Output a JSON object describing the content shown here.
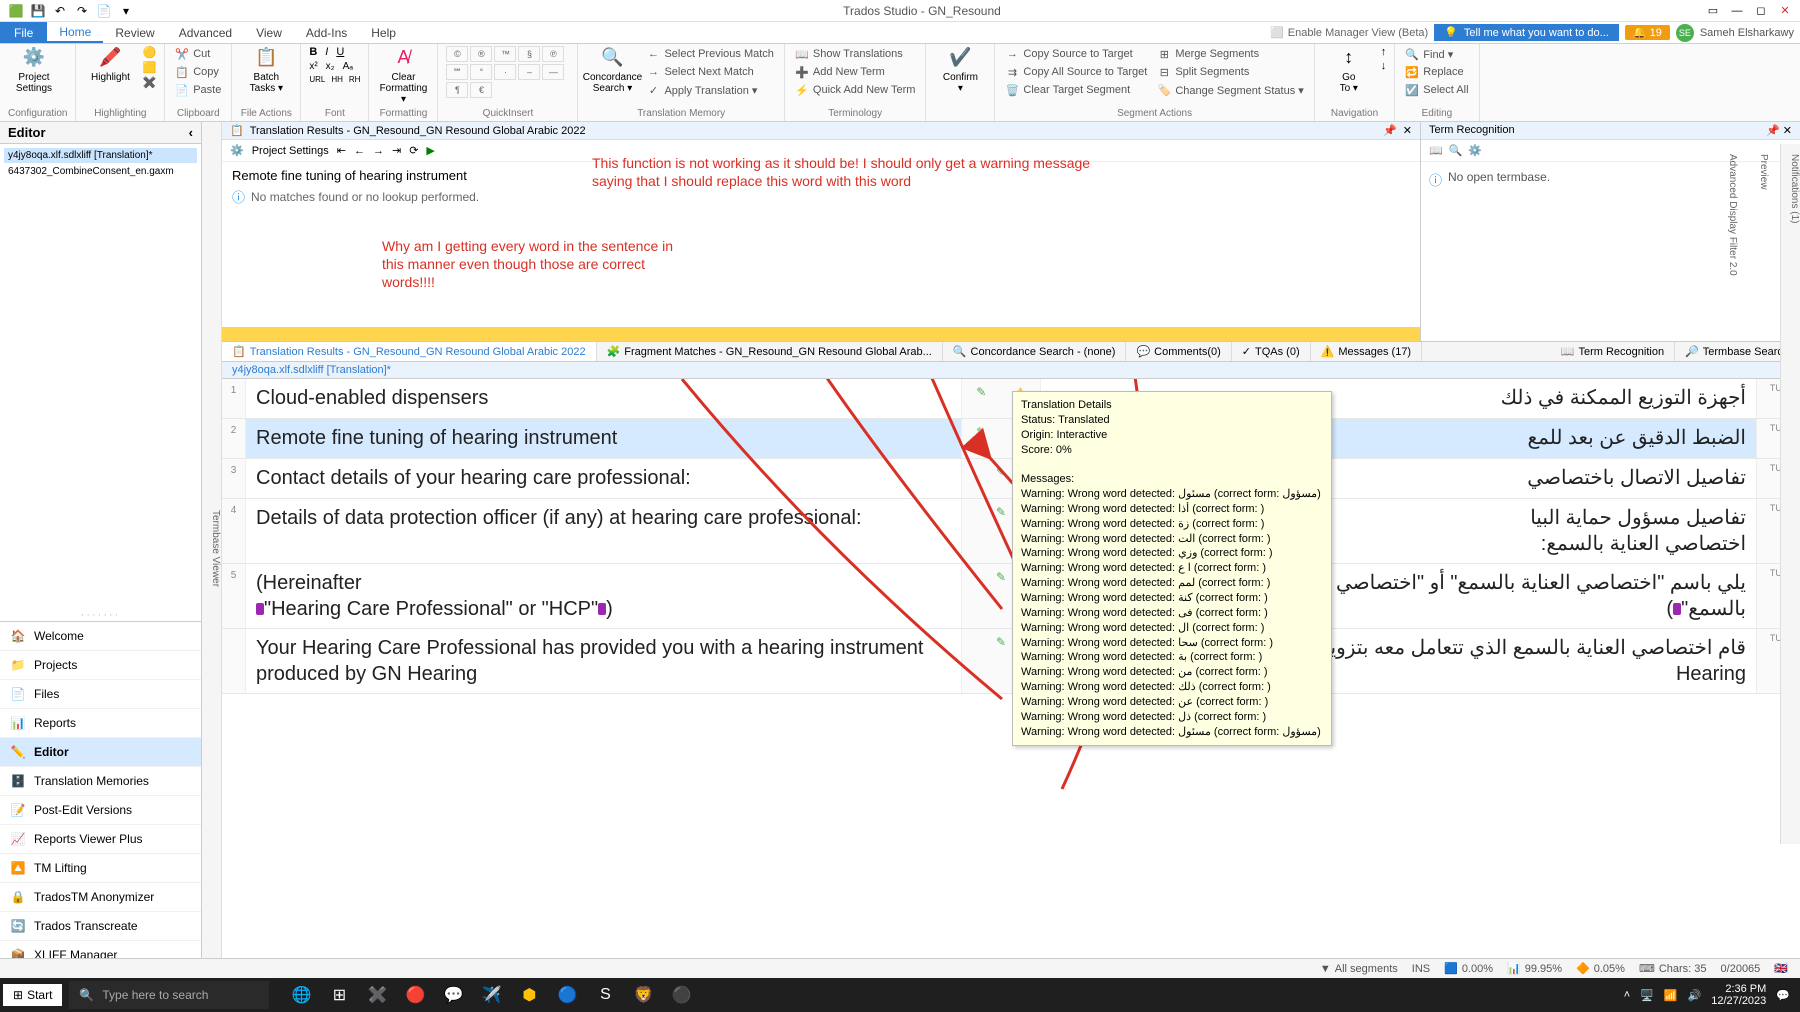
{
  "title": "Trados Studio - GN_Resound",
  "qat_icons": [
    "app",
    "save",
    "undo",
    "redo",
    "open",
    "more"
  ],
  "window_controls": [
    "ribbon-min",
    "min",
    "max",
    "close"
  ],
  "file_tab": "File",
  "tabs": [
    "Home",
    "Review",
    "Advanced",
    "View",
    "Add-Ins",
    "Help"
  ],
  "enable_manager": "Enable Manager View (Beta)",
  "tellme": "Tell me what you want to do...",
  "notif_count": "19",
  "user_name": "Sameh Elsharkawy",
  "user_initials": "SE",
  "ribbon": {
    "groups": [
      {
        "label": "Configuration",
        "big": [
          {
            "icon": "⚙️",
            "text": "Project\nSettings"
          }
        ]
      },
      {
        "label": "Highlighting",
        "big": [
          {
            "icon": "🖍️",
            "text": "Highlight"
          }
        ],
        "side": [
          "🟡",
          "🟨",
          "✖️"
        ]
      },
      {
        "label": "Clipboard",
        "items": [
          "Cut",
          "Copy",
          "Paste"
        ],
        "icons": [
          "✂️",
          "📋",
          "📄"
        ]
      },
      {
        "label": "File Actions",
        "big": [
          {
            "icon": "📋",
            "text": "Batch\nTasks ▾"
          }
        ]
      },
      {
        "label": "Font",
        "row1": [
          "B",
          "I",
          "U"
        ],
        "row2": [
          "x²",
          "x₂",
          "Aₐ"
        ],
        "row3": [
          "URL",
          "HH",
          "RH"
        ]
      },
      {
        "label": "Formatting",
        "big": [
          {
            "icon": "🧹",
            "text": "Clear\nFormatting ▾"
          }
        ]
      },
      {
        "label": "QuickInsert",
        "cells": [
          "©",
          "®",
          "™",
          "§",
          "℗",
          "℠",
          "°",
          "·",
          "–",
          "—",
          "¶",
          "€"
        ]
      },
      {
        "label": "Translation Memory",
        "big": [
          {
            "icon": "🔍",
            "text": "Concordance\nSearch ▾"
          }
        ],
        "items": [
          "Select Previous Match",
          "Select Next Match",
          "Apply Translation ▾"
        ],
        "icons": [
          "←",
          "→",
          "✓"
        ]
      },
      {
        "label": "Terminology",
        "items": [
          "Show Translations",
          "Add New Term",
          "Quick Add New Term"
        ],
        "icons": [
          "📖",
          "➕",
          "⚡"
        ]
      },
      {
        "label": "",
        "big": [
          {
            "icon": "✔️",
            "text": "Confirm\n▾"
          }
        ]
      },
      {
        "label": "Segment Actions",
        "items": [
          "Copy Source to Target",
          "Copy All Source to Target",
          "Clear Target Segment"
        ],
        "icons": [
          "→",
          "⇉",
          "🗑️"
        ],
        "items2": [
          "Merge Segments",
          "Split Segments",
          "Change Segment Status ▾"
        ]
      },
      {
        "label": "Navigation",
        "big": [
          {
            "icon": "↕",
            "text": "Go\nTo ▾"
          }
        ],
        "side": [
          "↑",
          "↓"
        ]
      },
      {
        "label": "Editing",
        "items": [
          "Find ▾",
          "Replace",
          "Select All"
        ],
        "icons": [
          "🔍",
          "🔁",
          "☑️"
        ]
      }
    ]
  },
  "editor_title": "Editor",
  "files": [
    "y4jy8oqa.xlf.sdlxliff [Translation]*",
    "6437302_CombineConsent_en.gaxm"
  ],
  "nav": [
    {
      "icon": "🏠",
      "label": "Welcome"
    },
    {
      "icon": "📁",
      "label": "Projects"
    },
    {
      "icon": "📄",
      "label": "Files"
    },
    {
      "icon": "📊",
      "label": "Reports"
    },
    {
      "icon": "✏️",
      "label": "Editor",
      "active": true
    },
    {
      "icon": "🗄️",
      "label": "Translation Memories"
    },
    {
      "icon": "📝",
      "label": "Post-Edit Versions"
    },
    {
      "icon": "📈",
      "label": "Reports Viewer Plus"
    },
    {
      "icon": "🔼",
      "label": "TM Lifting"
    },
    {
      "icon": "🔒",
      "label": "TradosTM Anonymizer"
    },
    {
      "icon": "🔄",
      "label": "Trados Transcreate"
    },
    {
      "icon": "📦",
      "label": "XLIFF Manager"
    }
  ],
  "termbase_viewer_label": "Termbase Viewer",
  "tm_header": "Translation Results - GN_Resound_GN Resound Global Arabic 2022",
  "project_settings_label": "Project Settings",
  "tm_source": "Remote fine tuning of hearing instrument",
  "tm_nomatch": "No matches found or no lookup performed.",
  "annotation1": "This function is not working as it should be! I should only get a warning message\nsaying that I should replace this word                       with this word",
  "annotation2": "Why am I getting every word in the sentence in\nthis manner even though those are correct\nwords!!!!",
  "term_recognition": "Term Recognition",
  "no_termbase": "No open termbase.",
  "bottom_tabs": [
    {
      "icon": "📋",
      "label": "Translation Results - GN_Resound_GN Resound Global Arabic 2022",
      "active": true
    },
    {
      "icon": "🧩",
      "label": "Fragment Matches - GN_Resound_GN Resound Global Arab..."
    },
    {
      "icon": "🔍",
      "label": "Concordance Search - (none)"
    },
    {
      "icon": "💬",
      "label": "Comments(0)"
    },
    {
      "icon": "✓",
      "label": "TQAs (0)"
    },
    {
      "icon": "⚠️",
      "label": "Messages (17)"
    }
  ],
  "bottom_tabs_right": [
    {
      "icon": "📖",
      "label": "Term Recognition"
    },
    {
      "icon": "🔎",
      "label": "Termbase Search"
    }
  ],
  "doc_tab": "y4jy8oqa.xlf.sdlxliff [Translation]*",
  "segments": [
    {
      "n": "1",
      "src": "Cloud-enabled dispensers",
      "tgt": "أجهزة التوزيع الممكنة في ذلك",
      "status": "TU+",
      "icons": [
        "edit",
        "warn"
      ]
    },
    {
      "n": "2",
      "src": "Remote fine tuning of hearing instrument",
      "tgt": "الضبط الدقيق عن بعد للمع",
      "status": "TU+",
      "active": true,
      "icons": [
        "edit",
        "warn"
      ]
    },
    {
      "n": "3",
      "src": "Contact details of your hearing care professional:",
      "tgt": "تفاصيل الاتصال باختصاصي",
      "status": "TU+",
      "icons": [
        "edit"
      ]
    },
    {
      "n": "4",
      "src": "Details of data protection officer (if any) at hearing care professional:",
      "tgt": "تفاصيل مسؤول حماية البيا\nاختصاصي العناية بالسمع:",
      "status": "TU+",
      "icons": [
        "edit"
      ]
    },
    {
      "n": "5",
      "src_pre": "(Hereinafter ",
      "tag1": "<g id=\"16\" mmq78catalogvalue=\"&lt;strong&gt;\" mmq78shortcatalogvalue=\"strong\">",
      "src_mid": "\"Hearing Care Professional\" or \"HCP\"",
      "tag2": "</g mmq78catalogvalue=\"&lt;/strong&gt;\" mmq78shortcatalogvalue=\"strong\">",
      "src_post": ")",
      "tgt_pre": "يلي باسم \"اختصاصي العناية بالسمع\" أو \"اختصاصي العناية",
      "tgt_tag": "</g mmq78catalogvalue=\"&lt;/strong&gt;\" mmq78shortcatalogvalue=\"strong\">",
      "tgt_post": "بالسمع\"",
      "tgt_post2": ")",
      "status": "TU+",
      "icons": [
        "edit"
      ],
      "has_tag_tgt": true
    },
    {
      "n": "",
      "src": "Your Hearing Care Professional has provided you with a hearing instrument produced by GN Hearing",
      "tgt": "قام اختصاصي العناية بالسمع الذي تتعامل معه بتزويدك بمعينة سمعية من إنتاج GN Hearing",
      "status": "TU+",
      "icons": [
        "edit"
      ]
    }
  ],
  "tooltip": {
    "header": [
      "Translation Details",
      "Status: Translated",
      "Origin: Interactive",
      "Score: 0%"
    ],
    "msg_title": "Messages:",
    "msgs": [
      "Warning: Wrong word detected: مسئول (correct form: مسؤول)",
      "Warning: Wrong word detected: أذا (correct form: )",
      "Warning: Wrong word detected: زة (correct form: )",
      "Warning: Wrong word detected: الت (correct form: )",
      "Warning: Wrong word detected: وزي (correct form: )",
      "Warning: Wrong word detected: ا ع (correct form: )",
      "Warning: Wrong word detected: لمم (correct form: )",
      "Warning: Wrong word detected: كنة (correct form: )",
      "Warning: Wrong word detected: فى (correct form: )",
      "Warning: Wrong word detected: ال (correct form: )",
      "Warning: Wrong word detected: سحا (correct form: )",
      "Warning: Wrong word detected: بة (correct form: )",
      "Warning: Wrong word detected: من (correct form: )",
      "Warning: Wrong word detected: ذلك (correct form: )",
      "Warning: Wrong word detected: عن (correct form: )",
      "Warning: Wrong word detected: ذل (correct form: )",
      "Warning: Wrong word detected: مسئول (correct form: مسؤول)"
    ]
  },
  "statusbar": {
    "filter": "All segments",
    "ins": "INS",
    "stats": [
      "0.00%",
      "99.95%",
      "0.05%",
      "Chars: 35",
      "0/20065"
    ],
    "lang_flag": "🇬🇧"
  },
  "right_strip": [
    "Notifications (1)",
    "Preview",
    "Advanced Display Filter 2.0"
  ],
  "taskbar": {
    "start": "Start",
    "search_placeholder": "Type here to search",
    "time": "2:36 PM",
    "date": "12/27/2023"
  }
}
